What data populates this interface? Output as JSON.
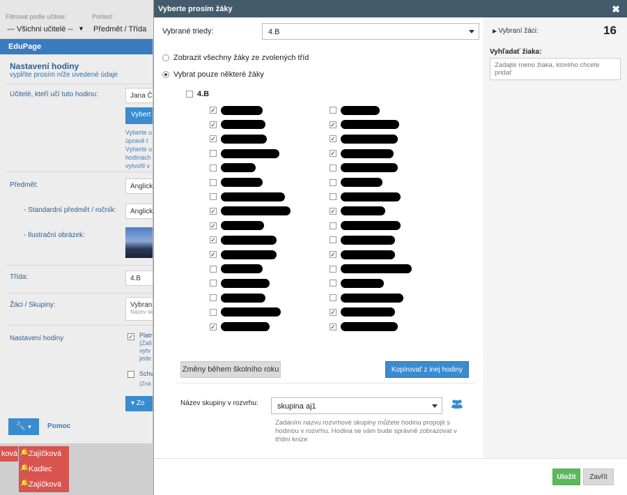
{
  "background": {
    "filter_teacher_label": "Filtrovat podle učitele:",
    "filter_teacher_value": "--- Všichni učitelé --",
    "view_label": "Pohled:",
    "view_value": "Předmět / Třída",
    "edupage": {
      "app_name": "EduPage",
      "title": "Nastavení hodiny",
      "subtitle": "vyplňte prosím níže uvedené údaje",
      "teachers_label": "Učitelé, kteří učí tuto hodinu:",
      "teacher_value": "Jana Č",
      "select_button": "Vybert",
      "help_lines": [
        "Vyberte u",
        "úpravě t",
        "Vyberte u",
        "hodinách",
        "vytvořil v"
      ],
      "subject_label": "Předmět:",
      "subject_value": "Anglick",
      "standard_label": "- Standardní předmět / ročník:",
      "standard_value": "Anglick",
      "image_label": "- Ilustrační obrázek:",
      "class_label": "Třída:",
      "class_value": "4.B",
      "students_label": "Žáci / Skupiny:",
      "students_value": "Vybran",
      "students_sub": "Název sk",
      "settings_label": "Nastavení hodiny",
      "setting1_lines": [
        "Platn",
        "(Zaš",
        "vytv",
        "jede"
      ],
      "setting2": "Schv",
      "setting2_sub": "(Zná",
      "ok_button": "Zo",
      "help_link": "Pomoc"
    },
    "timetable_cells": [
      "ková",
      "Zajíčková",
      "Kadlec",
      "Zajíčková"
    ]
  },
  "modal": {
    "title": "Vyberte prosím žáky",
    "classes_label": "Vybrané triedy:",
    "classes_value": "4.B",
    "radio_all": "Zobrazit všechny žáky ze zvolených tříd",
    "radio_some": "Vybrat pouze některé žáky",
    "class_group": "4.B",
    "changes_button": "Změny během školního roku",
    "copy_button": "Kopírovať z inej hodiny",
    "group_name_label": "Název skupiny v rozvrhu:",
    "group_name_value": "skupina aj1",
    "group_help": "Zadáním názvu rozvrhové skupiny můžete hodinu propojit s hodinou v rozvrhu. Hodina se vám bude správně zobrazovat v třídní knize",
    "selected_label": "Vybraní žáci:",
    "selected_count": "16",
    "search_label": "Vyhľadať žiaka:",
    "search_placeholder": "Zadajte meno žiaka, ktorého chcete pridať",
    "save_button": "Uložit",
    "close_button": "Zavřít",
    "students_col1": [
      true,
      true,
      true,
      false,
      false,
      false,
      false,
      true,
      true,
      true,
      true,
      false,
      false,
      false,
      false,
      true
    ],
    "students_col2": [
      false,
      true,
      true,
      true,
      false,
      false,
      false,
      true,
      false,
      false,
      true,
      false,
      false,
      false,
      true,
      true
    ]
  }
}
